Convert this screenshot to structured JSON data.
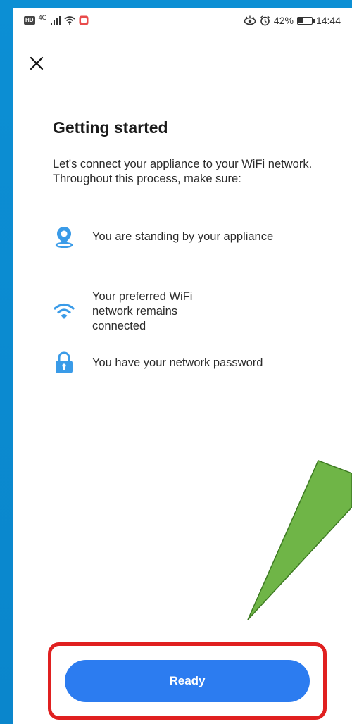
{
  "status_bar": {
    "hd_badge": "HD",
    "network": "4G",
    "battery_percent": "42%",
    "battery_level": 0.42,
    "time": "14:44"
  },
  "page": {
    "title": "Getting started",
    "intro": "Let's connect your appliance to your WiFi network. Throughout this process, make sure:"
  },
  "requirements": [
    {
      "icon": "location-pin-icon",
      "text": "You are standing by your appliance"
    },
    {
      "icon": "wifi-icon",
      "text": "Your preferred WiFi network remains connected"
    },
    {
      "icon": "lock-icon",
      "text": "You have your network password"
    }
  ],
  "actions": {
    "ready_label": "Ready"
  },
  "colors": {
    "accent": "#2c7cf0",
    "icon_blue": "#3a9be8",
    "highlight": "#e02020",
    "callout": "#6fb547",
    "frame": "#0c8fd4"
  }
}
